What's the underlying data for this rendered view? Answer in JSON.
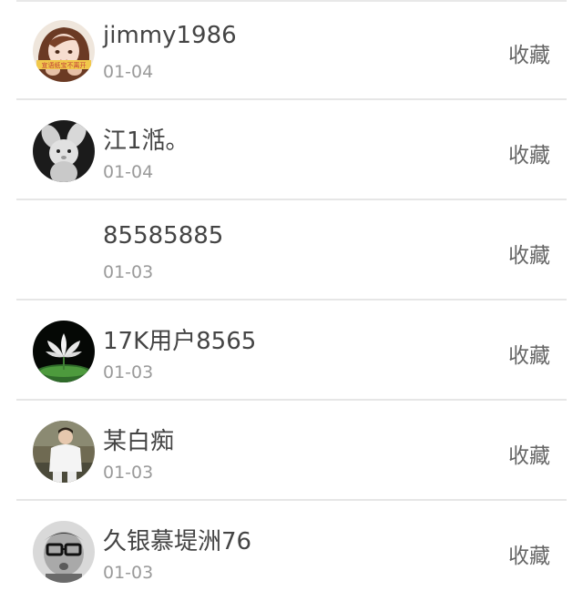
{
  "list": {
    "items": [
      {
        "name": "jimmy1986",
        "date": "01-04",
        "action": "收藏",
        "avatar_icon": "anime-girl-avatar-icon",
        "avatar_caption": "宣语纸宝不离开"
      },
      {
        "name": "江1湉。",
        "date": "01-04",
        "action": "收藏",
        "avatar_icon": "plush-bunny-avatar-icon"
      },
      {
        "name": "85585885",
        "date": "01-03",
        "action": "收藏",
        "avatar_icon": ""
      },
      {
        "name": "17K用户8565",
        "date": "01-03",
        "action": "收藏",
        "avatar_icon": "lotus-avatar-icon"
      },
      {
        "name": "某白痴",
        "date": "01-03",
        "action": "收藏",
        "avatar_icon": "person-photo-avatar-icon"
      },
      {
        "name": "久银慕堤洲76",
        "date": "01-03",
        "action": "收藏",
        "avatar_icon": "glasses-kid-avatar-icon"
      }
    ]
  }
}
